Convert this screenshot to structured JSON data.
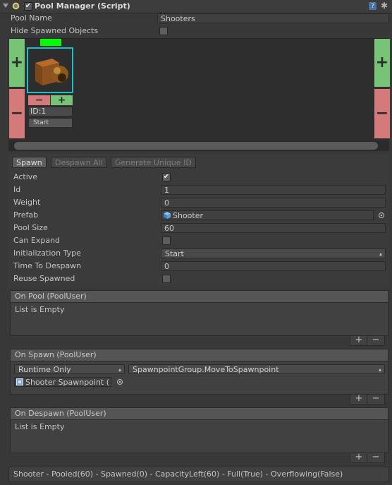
{
  "header": {
    "title": "Pool Manager (Script)",
    "enabled_check": "✔",
    "help": "?",
    "gear": "✱"
  },
  "fields": {
    "pool_name_label": "Pool Name",
    "pool_name_value": "Shooters",
    "hide_spawned_label": "Hide Spawned Objects"
  },
  "preview": {
    "add_symbol": "+",
    "remove_symbol": "−",
    "item": {
      "id_label": "ID:1",
      "start_label": "Start",
      "minus": "−",
      "plus": "+"
    }
  },
  "tabs": {
    "spawn": "Spawn",
    "despawn_all": "Despawn All",
    "generate_id": "Generate Unique ID"
  },
  "props": {
    "active_label": "Active",
    "active_check": "✔",
    "id_label": "Id",
    "id_value": "1",
    "weight_label": "Weight",
    "weight_value": "0",
    "prefab_label": "Prefab",
    "prefab_value": "Shooter",
    "pool_size_label": "Pool Size",
    "pool_size_value": "60",
    "can_expand_label": "Can Expand",
    "init_type_label": "Initialization Type",
    "init_type_value": "Start",
    "time_despawn_label": "Time To Despawn",
    "time_despawn_value": "0",
    "reuse_label": "Reuse Spawned"
  },
  "events": {
    "on_pool": {
      "title": "On Pool (PoolUser)",
      "empty": "List is Empty"
    },
    "on_spawn": {
      "title": "On Spawn (PoolUser)",
      "runtime": "Runtime Only",
      "method": "SpawnpointGroup.MoveToSpawnpoint",
      "object": "Shooter Spawnpoint ("
    },
    "on_despawn": {
      "title": "On Despawn (PoolUser)",
      "empty": "List is Empty"
    },
    "plus": "+",
    "minus": "−"
  },
  "status": "Shooter - Pooled(60) - Spawned(0) - CapacityLeft(60) - Full(True) - Overflowing(False)",
  "colors": {
    "add_green": "#77c477",
    "remove_red": "#d47a7a",
    "selection_cyan": "#19c0c8",
    "bright_green": "#00ff00"
  }
}
